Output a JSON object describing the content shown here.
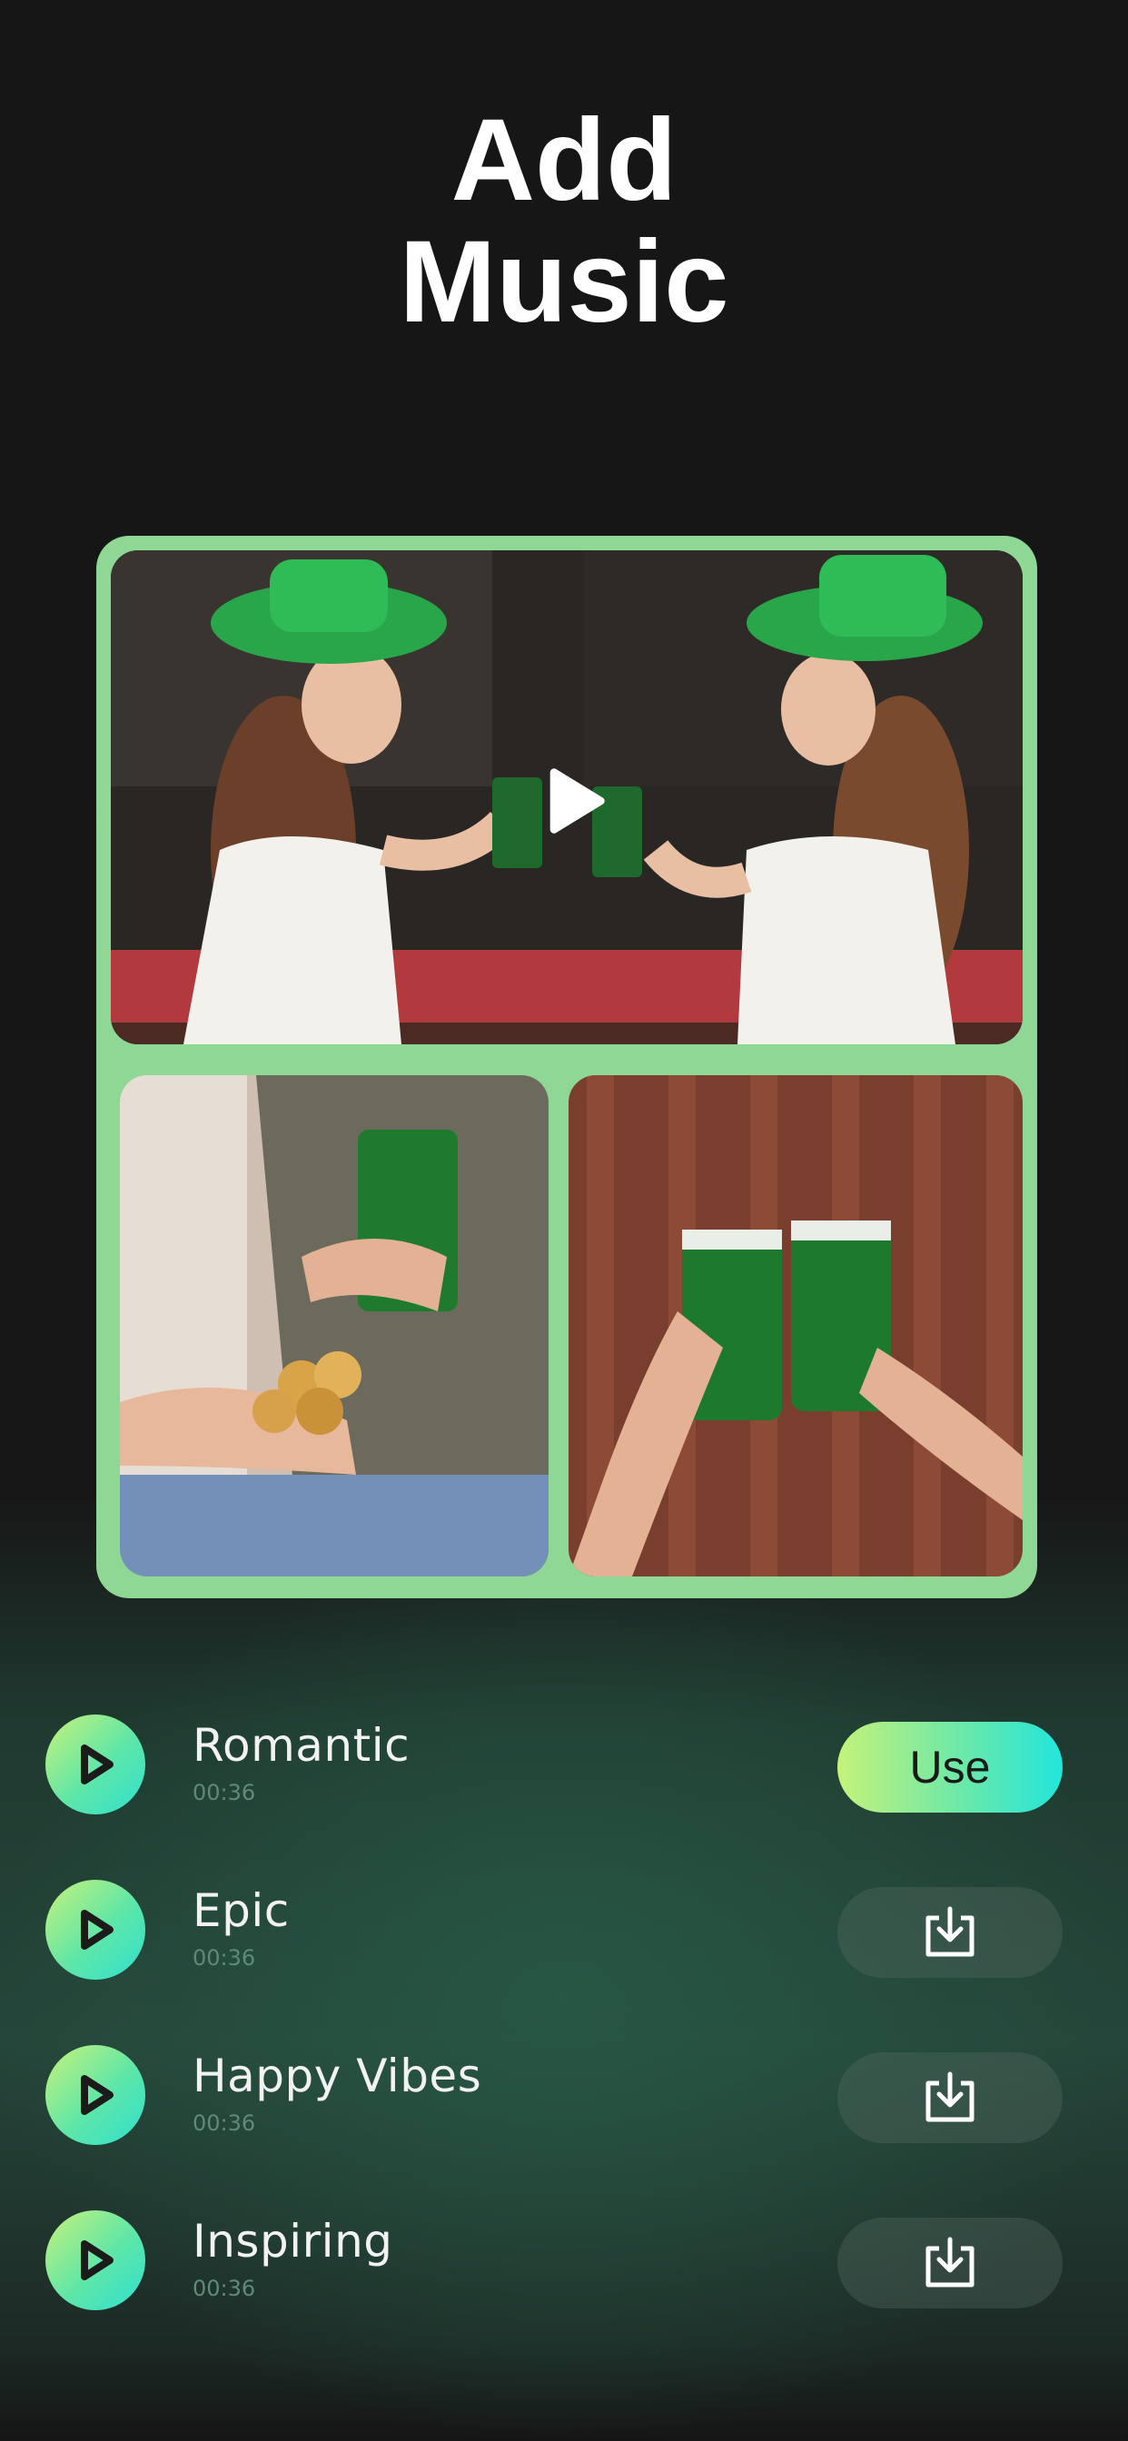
{
  "page": {
    "title_line1": "Add",
    "title_line2": "Music"
  },
  "collage": {
    "photos": [
      {
        "description_icon": "photo-two-women-toasting-icon"
      },
      {
        "description_icon": "photo-hands-coins-beer-icon"
      },
      {
        "description_icon": "photo-two-glasses-toast-icon"
      }
    ],
    "play_icon": "play-icon"
  },
  "tracks": [
    {
      "name": "Romantic",
      "duration": "00:36",
      "action": "use",
      "action_label": "Use"
    },
    {
      "name": "Epic",
      "duration": "00:36",
      "action": "download"
    },
    {
      "name": "Happy Vibes",
      "duration": "00:36",
      "action": "download"
    },
    {
      "name": "Inspiring",
      "duration": "00:36",
      "action": "download"
    }
  ],
  "colors": {
    "accent_start": "#c5f27a",
    "accent_end": "#22e6dc",
    "collage_frame": "#8fd795",
    "duration_text": "#5f8a78"
  }
}
